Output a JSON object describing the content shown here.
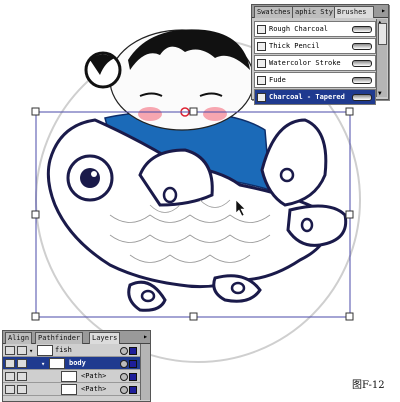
{
  "brushes_panel": {
    "tabs": [
      "Swatches",
      "aphic Sty",
      "Brushes"
    ],
    "active_tab": "Brushes",
    "menu_icon": "triangle-menu-icon",
    "items": [
      {
        "label": "Rough Charcoal"
      },
      {
        "label": "Thick Pencil"
      },
      {
        "label": "Watercolor Stroke"
      },
      {
        "label": "Fude"
      },
      {
        "label": "Charcoal - Tapered",
        "selected": true
      }
    ]
  },
  "layers_panel": {
    "tabs": [
      "Align",
      "Pathfinder",
      "Layers"
    ],
    "active_tab": "Layers",
    "rows": [
      {
        "label": "fish",
        "level": 0
      },
      {
        "label": "body",
        "level": 1,
        "selected": true
      },
      {
        "label": "<Path>",
        "level": 2
      },
      {
        "label": "<Path>",
        "level": 2
      }
    ]
  },
  "caption": "图F-12",
  "colors": {
    "accent": "#1f3a8f",
    "body_blue": "#1b6ab8",
    "outline": "#1a1a4a"
  }
}
